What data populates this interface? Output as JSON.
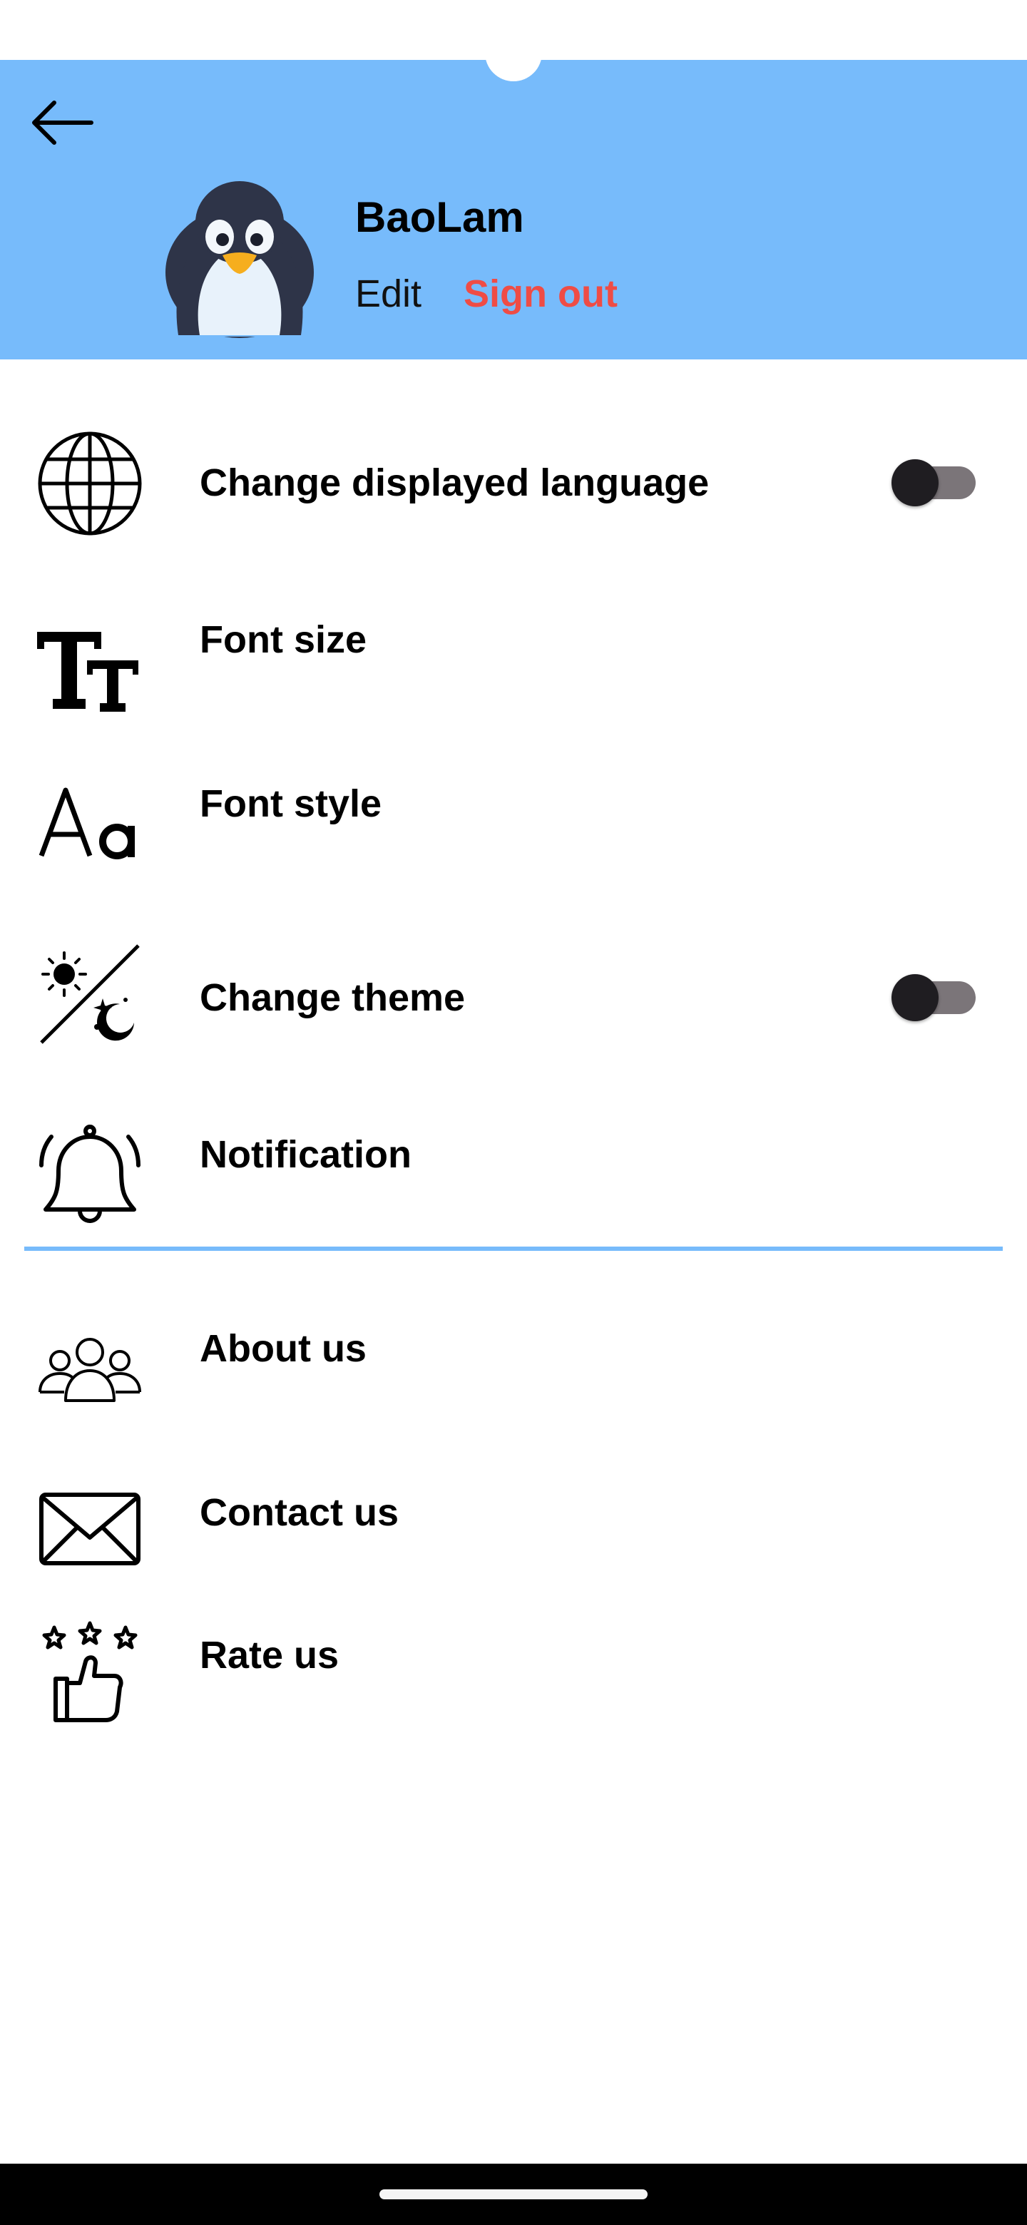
{
  "header": {
    "username": "BaoLam",
    "edit_label": "Edit",
    "signout_label": "Sign out",
    "background_color": "#77bbfb",
    "signout_color": "#ef4c45"
  },
  "settings": [
    {
      "label": "Change displayed language",
      "icon": "globe-icon",
      "toggle": "off"
    },
    {
      "label": "Font size",
      "icon": "font-size-icon"
    },
    {
      "label": "Font style",
      "icon": "font-style-icon"
    },
    {
      "label": "Change theme",
      "icon": "theme-icon",
      "toggle": "off"
    },
    {
      "label": "Notification",
      "icon": "bell-icon"
    }
  ],
  "info": [
    {
      "label": "About us",
      "icon": "people-icon"
    },
    {
      "label": "Contact us",
      "icon": "envelope-icon"
    },
    {
      "label": "Rate us",
      "icon": "rate-icon"
    }
  ]
}
